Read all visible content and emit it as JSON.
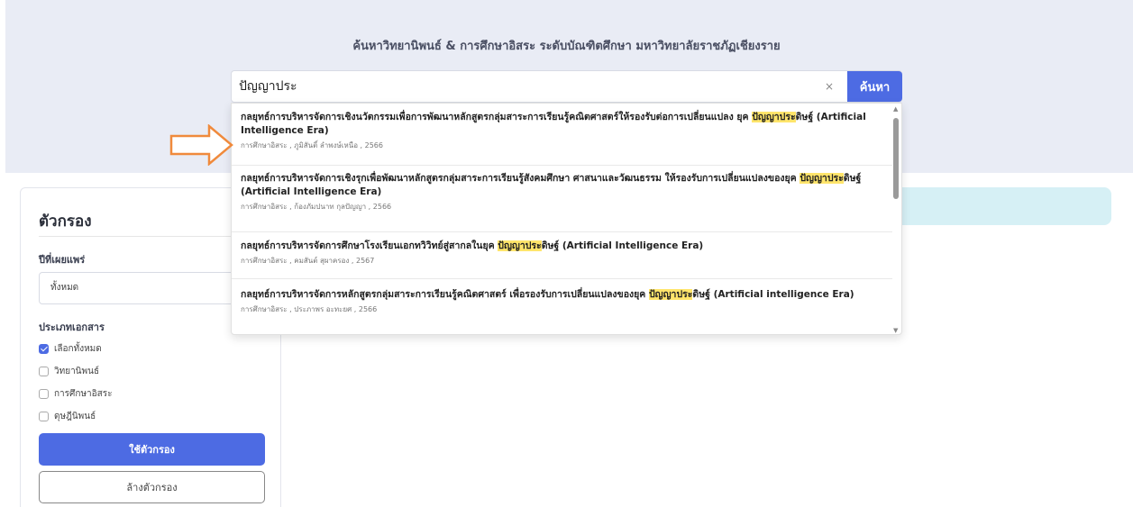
{
  "header": {
    "title": "ค้นหาวิทยานิพนธ์ & การศึกษาอิสระ ระดับบัณฑิตศึกษา มหาวิทยาลัยราชภัฏเชียงราย"
  },
  "search": {
    "value": "ปัญญาประ",
    "clear_icon": "×",
    "button_label": "ค้นหา"
  },
  "suggestions": [
    {
      "before": "กลยุทธ์การบริหารจัดการเชิงนวัตกรรมเพื่อการพัฒนาหลักสูตรกลุ่มสาระการเรียนรู้คณิตศาสตร์ให้รองรับต่อการเปลี่ยนแปลง ยุค ",
      "highlight": "ปัญญาประ",
      "after": "ดิษฐ์ (Artificial Intelligence Era)",
      "meta": "การศึกษาอิสระ , ภูมิสันติ์ ลำพงษ์เหนือ , 2566"
    },
    {
      "before": "กลยุทธ์การบริหารจัดการเชิงรุกเพื่อพัฒนาหลักสูตรกลุ่มสาระการเรียนรู้สังคมศึกษา ศาสนาและวัฒนธรรม ให้รองรับการเปลี่ยนแปลงของยุค ",
      "highlight": "ปัญญาประ",
      "after": "ดิษฐ์ (Artificial Intelligence Era)",
      "meta": "การศึกษาอิสระ , ก้องภัมปนาท กุลปัญญา , 2566"
    },
    {
      "before": "กลยุทธ์การบริหารจัดการศึกษาโรงเรียนเอกทวิวิทย์สู่สากลในยุค ",
      "highlight": "ปัญญาประ",
      "after": "ดิษฐ์ (Artificial Intelligence Era)",
      "meta": "การศึกษาอิสระ , คมสันต์ สุผาครอง , 2567"
    },
    {
      "before": "กลยุทธ์การบริหารจัดการหลักสูตรกลุ่มสาระการเรียนรู้คณิตศาสตร์ เพื่อรองรับการเปลี่ยนแปลงของยุค ",
      "highlight": "ปัญญาประ",
      "after": "ดิษฐ์ (Artificial intelligence Era)",
      "meta": "การศึกษาอิสระ , ประภาพร อะทะยศ , 2566"
    }
  ],
  "filters": {
    "title": "ตัวกรอง",
    "year_label": "ปีที่เผยแพร่",
    "year_value": "ทั้งหมด",
    "doctype_label": "ประเภทเอกสาร",
    "options": [
      {
        "label": "เลือกทั้งหมด",
        "checked": true
      },
      {
        "label": "วิทยานิพนธ์",
        "checked": false
      },
      {
        "label": "การศึกษาอิสระ",
        "checked": false
      },
      {
        "label": "ดุษฎีนิพนธ์",
        "checked": false
      }
    ],
    "apply_label": "ใช้ตัวกรอง",
    "clear_label": "ล้างตัวกรอง"
  },
  "colors": {
    "accent": "#4d6be3",
    "highlight": "#ffe56b",
    "annotation_arrow": "#f08a3c"
  }
}
